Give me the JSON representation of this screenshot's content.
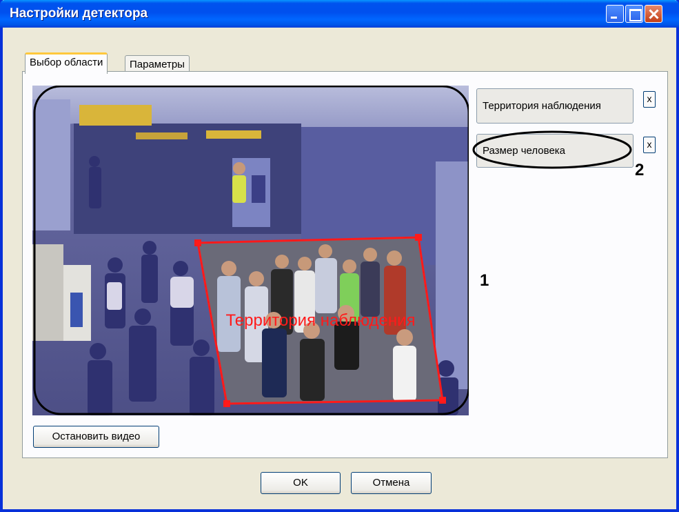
{
  "window": {
    "title": "Настройки детектора"
  },
  "tabs": [
    {
      "label": "Выбор области",
      "active": true
    },
    {
      "label": "Параметры",
      "active": false
    }
  ],
  "video": {
    "overlay_label": "Территория наблюдения",
    "stop_button": "Остановить видео",
    "accent_color": "#FF1A1A"
  },
  "areas": [
    {
      "label": "Территория наблюдения",
      "remove": "x"
    },
    {
      "label": "Размер человека",
      "remove": "x"
    }
  ],
  "callouts": {
    "one": "1",
    "two": "2"
  },
  "footer": {
    "ok": "OK",
    "cancel": "Отмена"
  }
}
